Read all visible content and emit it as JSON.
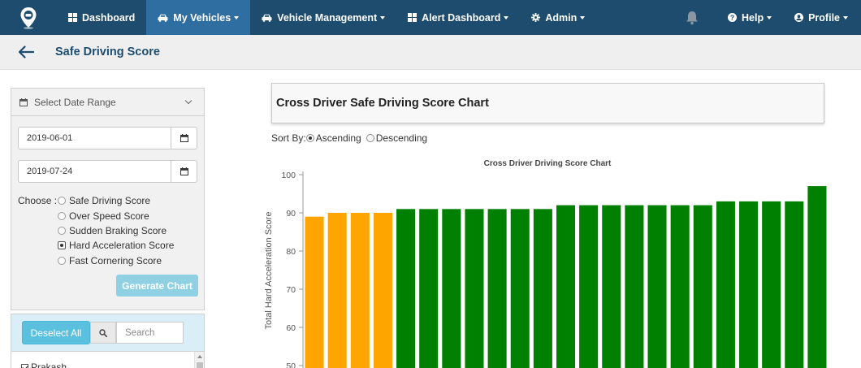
{
  "navbar": {
    "items": [
      {
        "label": "Dashboard",
        "icon": "dashboard-icon",
        "active": false
      },
      {
        "label": "My Vehicles",
        "icon": "car-icon",
        "active": true
      },
      {
        "label": "Vehicle Management",
        "icon": "car-icon",
        "active": false
      },
      {
        "label": "Alert Dashboard",
        "icon": "dashboard-icon",
        "active": false
      },
      {
        "label": "Admin",
        "icon": "gear-icon",
        "active": false
      }
    ],
    "right_items": [
      {
        "label": "Help",
        "icon": "question-circle-icon"
      },
      {
        "label": "Profile",
        "icon": "user-icon"
      }
    ],
    "colors": {
      "background": "#1d4c6e",
      "active": "#2f6ea1"
    }
  },
  "subheader": {
    "title": "Safe Driving Score"
  },
  "filters": {
    "date_range_label": "Select Date Range",
    "start_date": "2019-06-01",
    "end_date": "2019-07-24",
    "choose_label": "Choose :",
    "options": [
      {
        "label": "Safe Driving Score",
        "checked": false
      },
      {
        "label": "Over Speed Score",
        "checked": false
      },
      {
        "label": "Sudden Braking Score",
        "checked": false
      },
      {
        "label": "Hard Acceleration Score",
        "checked": true
      },
      {
        "label": "Fast Cornering Score",
        "checked": false
      }
    ],
    "generate_label": "Generate Chart"
  },
  "drivers": {
    "deselect_label": "Deselect All",
    "search_placeholder": "Search",
    "first_item": "Prakash"
  },
  "chart_header": {
    "title": "Cross Driver Safe Driving Score Chart"
  },
  "sort": {
    "label": "Sort By:",
    "asc": "Ascending",
    "desc": "Descending",
    "selected": "Ascending"
  },
  "chart_data": {
    "type": "bar",
    "title": "Cross Driver Driving Score Chart",
    "ylabel": "Total Hard Acceleration Score",
    "xlabel": "",
    "ylim": [
      50,
      100
    ],
    "yticks": [
      50,
      60,
      70,
      80,
      90,
      100
    ],
    "grid": false,
    "values": [
      89,
      90,
      90,
      90,
      91,
      91,
      91,
      91,
      91,
      91,
      91,
      92,
      92,
      92,
      92,
      92,
      92,
      92,
      93,
      93,
      93,
      93,
      97
    ],
    "colors": [
      "#ffa500",
      "#ffa500",
      "#ffa500",
      "#ffa500",
      "#008000",
      "#008000",
      "#008000",
      "#008000",
      "#008000",
      "#008000",
      "#008000",
      "#008000",
      "#008000",
      "#008000",
      "#008000",
      "#008000",
      "#008000",
      "#008000",
      "#008000",
      "#008000",
      "#008000",
      "#008000",
      "#008000"
    ]
  }
}
